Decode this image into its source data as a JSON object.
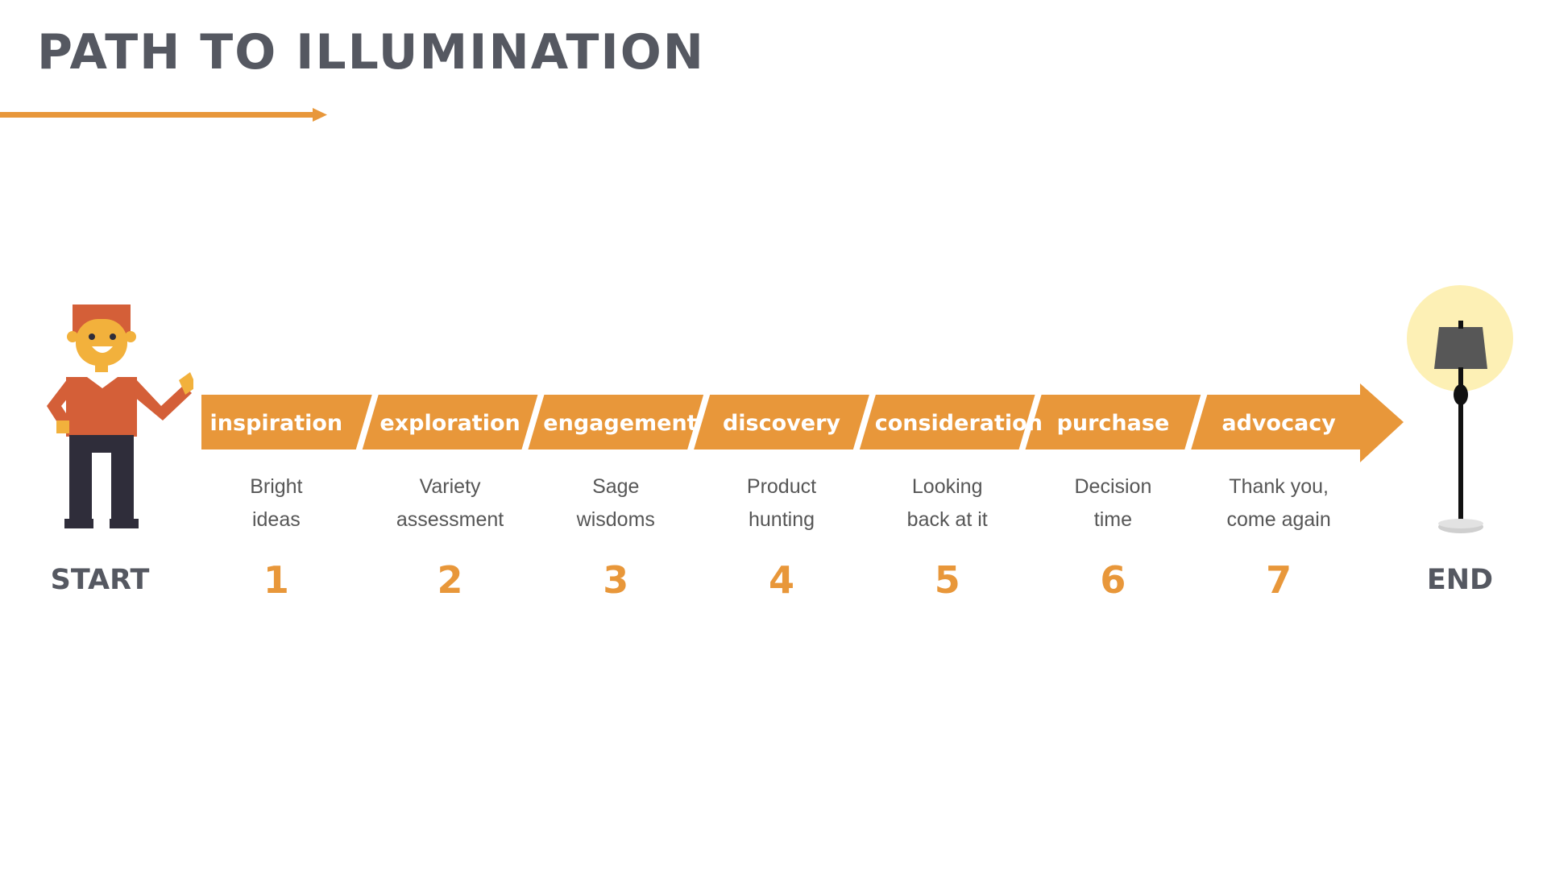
{
  "title": "PATH TO ILLUMINATION",
  "start_label": "START",
  "end_label": "END",
  "colors": {
    "accent": "#e8973a",
    "title": "#555861",
    "text": "#565656",
    "lamp_glow": "#fdf0b5"
  },
  "icons": {
    "start": "person-icon",
    "end": "floor-lamp-icon"
  },
  "stages": [
    {
      "number": "1",
      "label": "inspiration",
      "desc": [
        "Bright",
        "ideas"
      ]
    },
    {
      "number": "2",
      "label": "exploration",
      "desc": [
        "Variety",
        "assessment"
      ]
    },
    {
      "number": "3",
      "label": "engagement",
      "desc": [
        "Sage",
        "wisdoms"
      ]
    },
    {
      "number": "4",
      "label": "discovery",
      "desc": [
        "Product",
        "hunting"
      ]
    },
    {
      "number": "5",
      "label": "consideration",
      "desc": [
        "Looking",
        "back at it"
      ]
    },
    {
      "number": "6",
      "label": "purchase",
      "desc": [
        "Decision",
        "time"
      ]
    },
    {
      "number": "7",
      "label": "advocacy",
      "desc": [
        "Thank you,",
        "come again"
      ]
    }
  ]
}
